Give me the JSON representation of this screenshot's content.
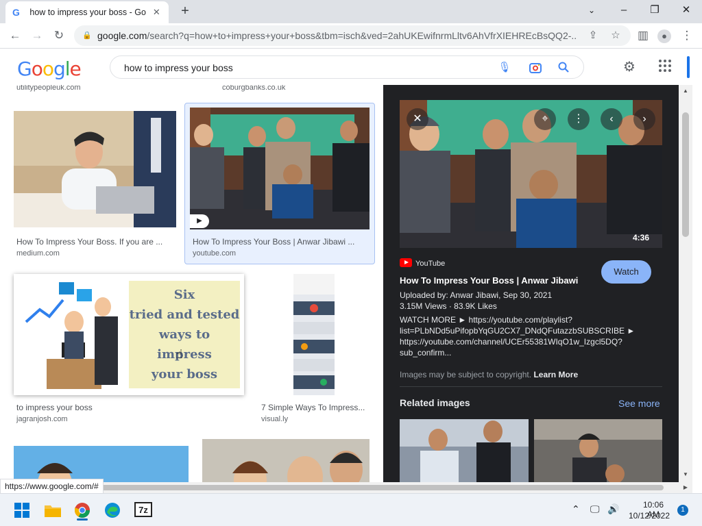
{
  "browser": {
    "tab_title": "how to impress your boss - Goog",
    "favicon": "G",
    "url_host": "google.com",
    "url_path": "/search?q=how+to+impress+your+boss&tbm=isch&ved=2ahUKEwifnrmLltv6AhVfrXIEHREcBsQQ2-..."
  },
  "google": {
    "logo": [
      "G",
      "o",
      "o",
      "g",
      "l",
      "e"
    ],
    "logo_colors": [
      "#4285f4",
      "#ea4335",
      "#fbbc05",
      "#4285f4",
      "#34a853",
      "#ea4335"
    ],
    "query": "how to impress your boss"
  },
  "results": {
    "top_sources": [
      "utilitypeopleuk.com",
      "coburgbanks.co.uk"
    ],
    "items": [
      {
        "caption": "How To Impress Your Boss. If you are ...",
        "source": "medium.com"
      },
      {
        "caption": "How To Impress Your Boss | Anwar Jibawi ...",
        "source": "youtube.com"
      },
      {
        "caption": "to impress your boss",
        "source": "jagranjosh.com"
      },
      {
        "caption": "7 Simple Ways To Impress...",
        "source": "visual.ly"
      }
    ],
    "boss_poster_text": [
      "Six",
      "tried and tested",
      "ways to",
      "impress",
      "your boss"
    ]
  },
  "preview": {
    "duration": "4:36",
    "site": "YouTube",
    "watch_label": "Watch",
    "title": "How To Impress Your Boss | Anwar Jibawi",
    "uploaded": "Uploaded by: Anwar Jibawi, Sep 30, 2021",
    "stats": "3.15M Views  ·  83.9K Likes",
    "desc": [
      "WATCH MORE ► https://youtube.com/playlist?",
      "list=PLbNDd5uPifopbYqGU2CX7_DNdQFutazzbSUBSCRIBE ►",
      "https://youtube.com/channel/UCEr55381WIqO1w_Izgcl5DQ?",
      "sub_confirm..."
    ],
    "copyright": "Images may be subject to copyright.",
    "learn_more": "Learn More",
    "related": "Related images",
    "see_more": "See more"
  },
  "status_url": "https://www.google.com/#",
  "taskbar": {
    "time": "10:06 AM",
    "date": "10/12/2022",
    "notifications": "1",
    "app_7z": "7z"
  }
}
